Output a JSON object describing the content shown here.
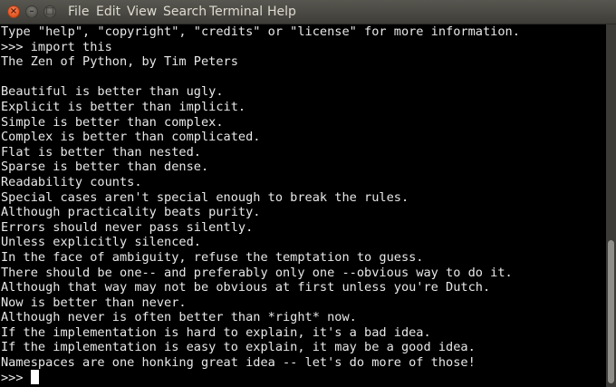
{
  "window": {
    "buttons": {
      "close": "×",
      "minimize": "–",
      "maximize": "□"
    }
  },
  "menu": {
    "items": [
      "File",
      "Edit",
      "View",
      "Search",
      "Terminal",
      "Help"
    ]
  },
  "terminal": {
    "lines": [
      "Type \"help\", \"copyright\", \"credits\" or \"license\" for more information.",
      ">>> import this",
      "The Zen of Python, by Tim Peters",
      "",
      "Beautiful is better than ugly.",
      "Explicit is better than implicit.",
      "Simple is better than complex.",
      "Complex is better than complicated.",
      "Flat is better than nested.",
      "Sparse is better than dense.",
      "Readability counts.",
      "Special cases aren't special enough to break the rules.",
      "Although practicality beats purity.",
      "Errors should never pass silently.",
      "Unless explicitly silenced.",
      "In the face of ambiguity, refuse the temptation to guess.",
      "There should be one-- and preferably only one --obvious way to do it.",
      "Although that way may not be obvious at first unless you're Dutch.",
      "Now is better than never.",
      "Although never is often better than *right* now.",
      "If the implementation is hard to explain, it's a bad idea.",
      "If the implementation is easy to explain, it may be a good idea.",
      "Namespaces are one honking great idea -- let's do more of those!"
    ],
    "prompt": ">>> "
  },
  "colors": {
    "background": "#000000",
    "text": "#e8e8e8",
    "menubar": "#3e3d38",
    "close_button": "#e2541e"
  },
  "icons": {
    "close": "close-icon",
    "minimize": "minimize-icon",
    "maximize": "maximize-icon",
    "cursor": "text-cursor"
  }
}
